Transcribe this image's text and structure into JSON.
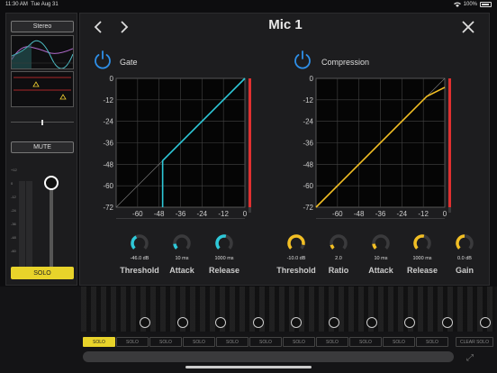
{
  "status": {
    "time": "11:30 AM",
    "date": "Tue Aug 31",
    "battery": "100%"
  },
  "channel": {
    "stereo_label": "Stereo",
    "mute_label": "MUTE",
    "solo_label": "SOLO",
    "scale": [
      "+12",
      "0",
      "-12",
      "-24",
      "-36",
      "-48",
      "-60"
    ]
  },
  "dialog": {
    "title": "Mic 1",
    "gate": {
      "label": "Gate",
      "y_ticks": [
        "0",
        "-12",
        "-24",
        "-36",
        "-48",
        "-60",
        "-72"
      ],
      "x_ticks": [
        "-60",
        "-48",
        "-36",
        "-24",
        "-12",
        "0"
      ],
      "knobs": [
        {
          "label": "Threshold",
          "value": "-46.0 dB",
          "level": 0.4
        },
        {
          "label": "Attack",
          "value": "10 ms",
          "level": 0.15
        },
        {
          "label": "Release",
          "value": "1000 ms",
          "level": 0.55
        }
      ],
      "color": "#2ec8d8"
    },
    "compression": {
      "label": "Compression",
      "y_ticks": [
        "0",
        "-12",
        "-24",
        "-36",
        "-48",
        "-60",
        "-72"
      ],
      "x_ticks": [
        "-60",
        "-48",
        "-36",
        "-24",
        "-12",
        "0"
      ],
      "knobs": [
        {
          "label": "Threshold",
          "value": "-10.0  dB",
          "level": 0.88
        },
        {
          "label": "Ratio",
          "value": "2.0",
          "level": 0.12
        },
        {
          "label": "Attack",
          "value": "10  ms",
          "level": 0.15
        },
        {
          "label": "Release",
          "value": "1000 ms",
          "level": 0.55
        },
        {
          "label": "Gain",
          "value": "0.0 dB",
          "level": 0.5
        }
      ],
      "color": "#f2bf24"
    }
  },
  "background": {
    "solo_buttons": [
      "SOLO",
      "SOLO",
      "SOLO",
      "SOLO",
      "SOLO",
      "SOLO",
      "SOLO",
      "SOLO",
      "SOLO",
      "SOLO",
      "SOLO",
      "SOLO"
    ],
    "clear_solo": "CLEAR SOLO"
  },
  "colors": {
    "accent_blue": "#2e8fe8",
    "solo_yellow": "#e8d32a",
    "meter_red": "#e03030"
  }
}
